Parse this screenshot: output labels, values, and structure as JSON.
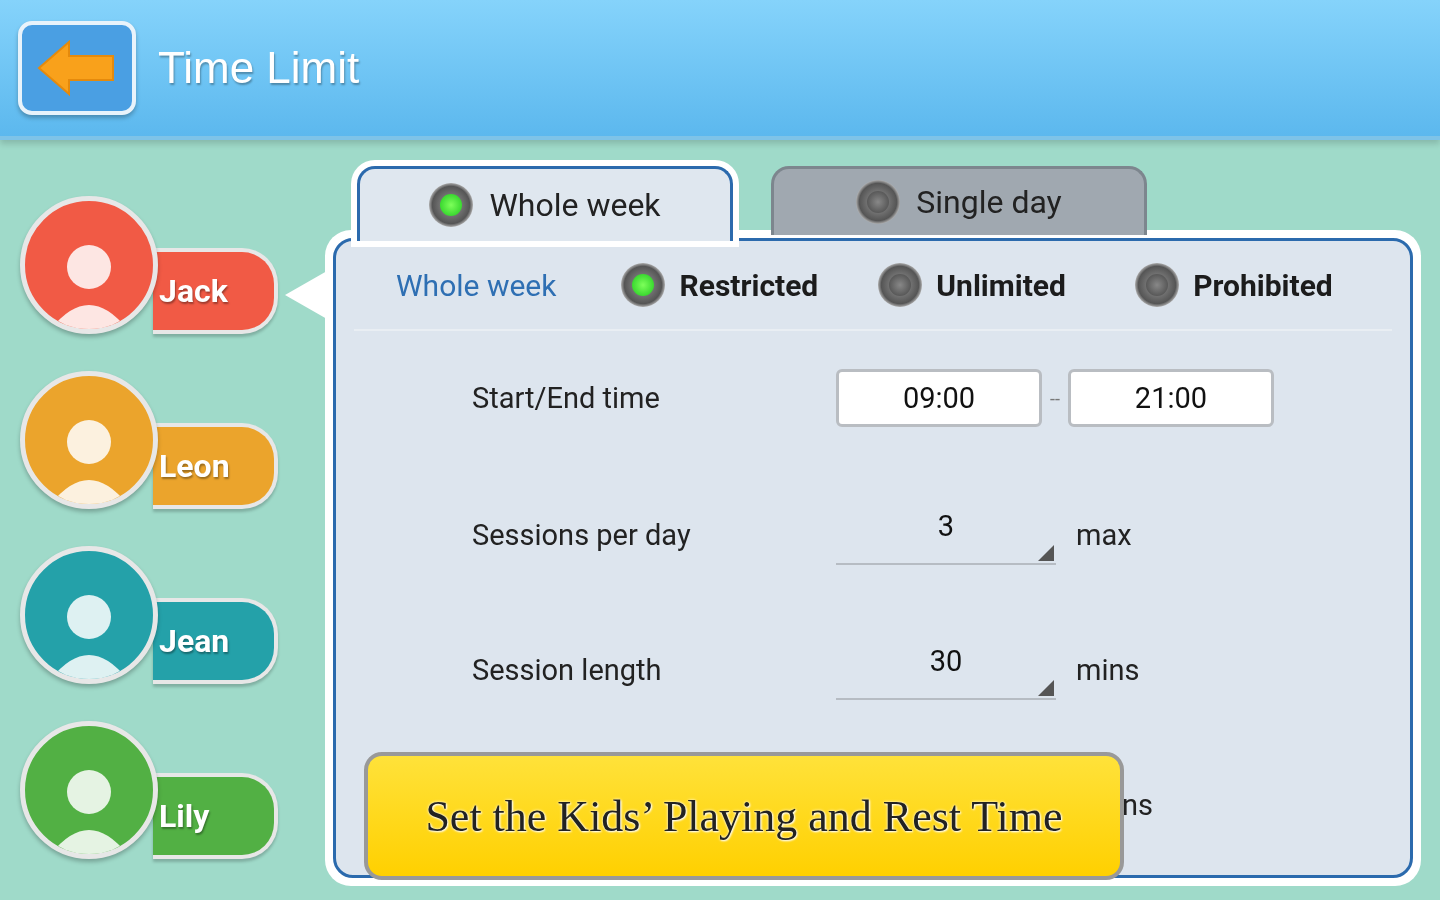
{
  "header": {
    "title": "Time Limit"
  },
  "kids": [
    {
      "name": "Jack",
      "color": "#f15a45",
      "selected": true
    },
    {
      "name": "Leon",
      "color": "#eba42c",
      "selected": false
    },
    {
      "name": "Jean",
      "color": "#24a1a9",
      "selected": false
    },
    {
      "name": "Lily",
      "color": "#52b044",
      "selected": false
    }
  ],
  "tabs": [
    {
      "label": "Whole week",
      "selected": true
    },
    {
      "label": "Single day",
      "selected": false
    }
  ],
  "mode": {
    "label": "Whole week",
    "options": [
      {
        "label": "Restricted",
        "selected": true
      },
      {
        "label": "Unlimited",
        "selected": false
      },
      {
        "label": "Prohibited",
        "selected": false
      }
    ]
  },
  "settings": [
    {
      "kind": "time_range",
      "label": "Start/End time",
      "start": "09:00",
      "separator": "--",
      "end": "21:00"
    },
    {
      "kind": "number",
      "label": "Sessions per day",
      "value": "3",
      "unit": "max"
    },
    {
      "kind": "number",
      "label": "Session length",
      "value": "30",
      "unit": "mins"
    },
    {
      "kind": "hidden",
      "unit": "ns"
    }
  ],
  "banner": {
    "text": "Set the Kids’ Playing and Rest Time"
  }
}
